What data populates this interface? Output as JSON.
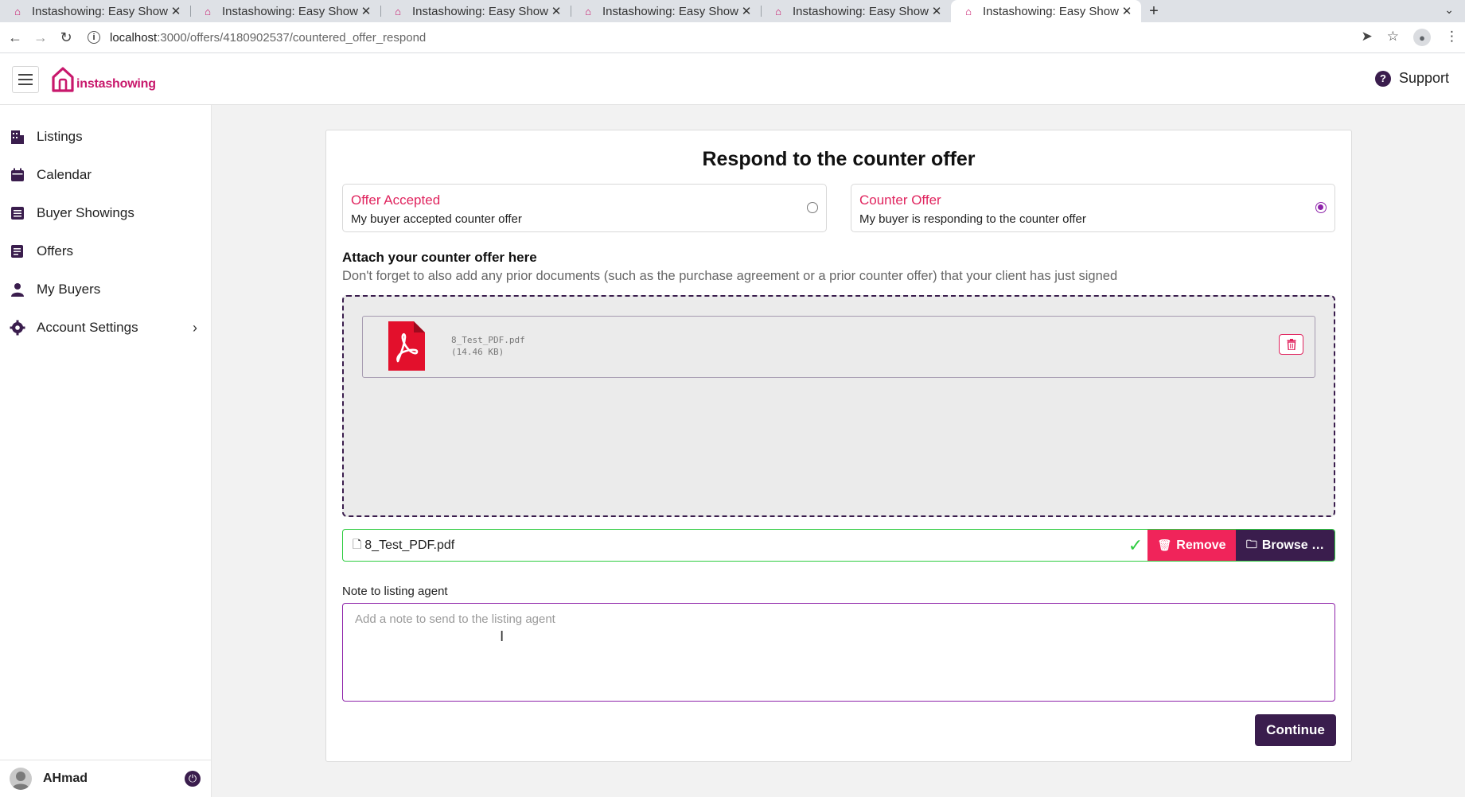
{
  "browser": {
    "tabs": [
      {
        "title": "Instashowing: Easy Show"
      },
      {
        "title": "Instashowing: Easy Show"
      },
      {
        "title": "Instashowing: Easy Show"
      },
      {
        "title": "Instashowing: Easy Show"
      },
      {
        "title": "Instashowing: Easy Show"
      },
      {
        "title": "Instashowing: Easy Show"
      }
    ],
    "url_host": "localhost",
    "url_path": ":3000/offers/4180902537/countered_offer_respond"
  },
  "header": {
    "brand": "instashowing",
    "support_label": "Support"
  },
  "sidebar": {
    "items": [
      {
        "label": "Listings",
        "icon": "listings-icon"
      },
      {
        "label": "Calendar",
        "icon": "calendar-icon"
      },
      {
        "label": "Buyer Showings",
        "icon": "showings-icon"
      },
      {
        "label": "Offers",
        "icon": "offers-icon"
      },
      {
        "label": "My Buyers",
        "icon": "person-icon"
      },
      {
        "label": "Account Settings",
        "icon": "gear-icon"
      }
    ],
    "user_name": "AHmad"
  },
  "main": {
    "title": "Respond to the counter offer",
    "options": [
      {
        "title": "Offer Accepted",
        "subtitle": "My buyer accepted counter offer",
        "selected": false
      },
      {
        "title": "Counter Offer",
        "subtitle": "My buyer is responding to the counter offer",
        "selected": true
      }
    ],
    "attach_heading": "Attach your counter offer here",
    "attach_help": "Don't forget to also add any prior documents (such as the purchase agreement or a prior counter offer) that your client has just signed",
    "file": {
      "name": "8_Test_PDF.pdf",
      "size": "(14.46 KB)"
    },
    "file_input_value": "8_Test_PDF.pdf",
    "remove_label": "Remove",
    "browse_label": "Browse …",
    "note_label": "Note to listing agent",
    "note_placeholder": "Add a note to send to the listing agent",
    "continue_label": "Continue"
  },
  "colors": {
    "brand": "#c8186c",
    "primary_dark": "#3a1d4d",
    "danger": "#f0245a",
    "success": "#2ecc40",
    "accent_purple": "#8e24aa"
  }
}
